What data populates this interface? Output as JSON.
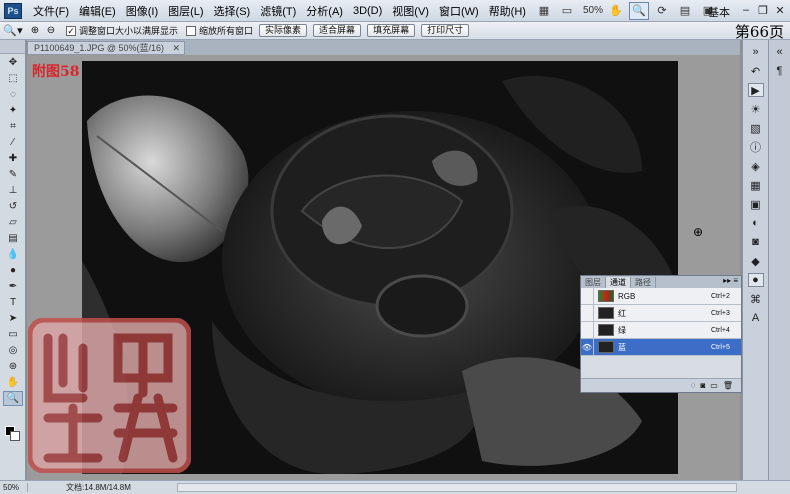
{
  "app": {
    "logo": "Ps",
    "workspace": "基本",
    "zoom_select": "50%"
  },
  "menu": [
    "文件(F)",
    "编辑(E)",
    "图像(I)",
    "图层(L)",
    "选择(S)",
    "滤镜(T)",
    "分析(A)",
    "3D(D)",
    "视图(V)",
    "窗口(W)",
    "帮助(H)"
  ],
  "options": {
    "resize_windows": "调整窗口大小以满屏显示",
    "zoom_all": "缩放所有窗口",
    "btn_actual": "实际像素",
    "btn_fit": "适合屏幕",
    "btn_fill": "填充屏幕",
    "btn_print": "打印尺寸"
  },
  "page_label": "第66页",
  "document": {
    "tab_title": "P1100649_1.JPG @ 50%(蓝/16)",
    "annotation": "附图58"
  },
  "channels": {
    "tabs": [
      "图层",
      "通道",
      "路径"
    ],
    "rows": [
      {
        "name": "RGB",
        "key": "Ctrl+2"
      },
      {
        "name": "红",
        "key": "Ctrl+3"
      },
      {
        "name": "绿",
        "key": "Ctrl+4"
      },
      {
        "name": "蓝",
        "key": "Ctrl+5"
      }
    ]
  },
  "status": {
    "zoom": "50%",
    "doc": "文档:14.8M/14.8M"
  }
}
